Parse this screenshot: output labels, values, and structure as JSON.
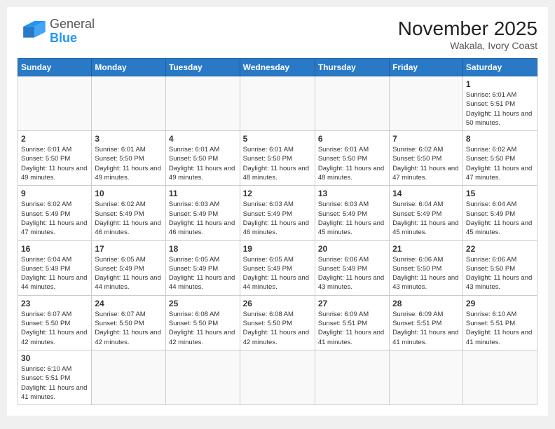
{
  "header": {
    "logo": {
      "line1": "General",
      "line2": "Blue"
    },
    "title": "November 2025",
    "location": "Wakala, Ivory Coast"
  },
  "weekdays": [
    "Sunday",
    "Monday",
    "Tuesday",
    "Wednesday",
    "Thursday",
    "Friday",
    "Saturday"
  ],
  "weeks": [
    [
      {
        "day": "",
        "info": ""
      },
      {
        "day": "",
        "info": ""
      },
      {
        "day": "",
        "info": ""
      },
      {
        "day": "",
        "info": ""
      },
      {
        "day": "",
        "info": ""
      },
      {
        "day": "",
        "info": ""
      },
      {
        "day": "1",
        "info": "Sunrise: 6:01 AM\nSunset: 5:51 PM\nDaylight: 11 hours\nand 50 minutes."
      }
    ],
    [
      {
        "day": "2",
        "info": "Sunrise: 6:01 AM\nSunset: 5:50 PM\nDaylight: 11 hours\nand 49 minutes."
      },
      {
        "day": "3",
        "info": "Sunrise: 6:01 AM\nSunset: 5:50 PM\nDaylight: 11 hours\nand 49 minutes."
      },
      {
        "day": "4",
        "info": "Sunrise: 6:01 AM\nSunset: 5:50 PM\nDaylight: 11 hours\nand 49 minutes."
      },
      {
        "day": "5",
        "info": "Sunrise: 6:01 AM\nSunset: 5:50 PM\nDaylight: 11 hours\nand 48 minutes."
      },
      {
        "day": "6",
        "info": "Sunrise: 6:01 AM\nSunset: 5:50 PM\nDaylight: 11 hours\nand 48 minutes."
      },
      {
        "day": "7",
        "info": "Sunrise: 6:02 AM\nSunset: 5:50 PM\nDaylight: 11 hours\nand 47 minutes."
      },
      {
        "day": "8",
        "info": "Sunrise: 6:02 AM\nSunset: 5:50 PM\nDaylight: 11 hours\nand 47 minutes."
      }
    ],
    [
      {
        "day": "9",
        "info": "Sunrise: 6:02 AM\nSunset: 5:49 PM\nDaylight: 11 hours\nand 47 minutes."
      },
      {
        "day": "10",
        "info": "Sunrise: 6:02 AM\nSunset: 5:49 PM\nDaylight: 11 hours\nand 46 minutes."
      },
      {
        "day": "11",
        "info": "Sunrise: 6:03 AM\nSunset: 5:49 PM\nDaylight: 11 hours\nand 46 minutes."
      },
      {
        "day": "12",
        "info": "Sunrise: 6:03 AM\nSunset: 5:49 PM\nDaylight: 11 hours\nand 46 minutes."
      },
      {
        "day": "13",
        "info": "Sunrise: 6:03 AM\nSunset: 5:49 PM\nDaylight: 11 hours\nand 45 minutes."
      },
      {
        "day": "14",
        "info": "Sunrise: 6:04 AM\nSunset: 5:49 PM\nDaylight: 11 hours\nand 45 minutes."
      },
      {
        "day": "15",
        "info": "Sunrise: 6:04 AM\nSunset: 5:49 PM\nDaylight: 11 hours\nand 45 minutes."
      }
    ],
    [
      {
        "day": "16",
        "info": "Sunrise: 6:04 AM\nSunset: 5:49 PM\nDaylight: 11 hours\nand 44 minutes."
      },
      {
        "day": "17",
        "info": "Sunrise: 6:05 AM\nSunset: 5:49 PM\nDaylight: 11 hours\nand 44 minutes."
      },
      {
        "day": "18",
        "info": "Sunrise: 6:05 AM\nSunset: 5:49 PM\nDaylight: 11 hours\nand 44 minutes."
      },
      {
        "day": "19",
        "info": "Sunrise: 6:05 AM\nSunset: 5:49 PM\nDaylight: 11 hours\nand 44 minutes."
      },
      {
        "day": "20",
        "info": "Sunrise: 6:06 AM\nSunset: 5:49 PM\nDaylight: 11 hours\nand 43 minutes."
      },
      {
        "day": "21",
        "info": "Sunrise: 6:06 AM\nSunset: 5:50 PM\nDaylight: 11 hours\nand 43 minutes."
      },
      {
        "day": "22",
        "info": "Sunrise: 6:06 AM\nSunset: 5:50 PM\nDaylight: 11 hours\nand 43 minutes."
      }
    ],
    [
      {
        "day": "23",
        "info": "Sunrise: 6:07 AM\nSunset: 5:50 PM\nDaylight: 11 hours\nand 42 minutes."
      },
      {
        "day": "24",
        "info": "Sunrise: 6:07 AM\nSunset: 5:50 PM\nDaylight: 11 hours\nand 42 minutes."
      },
      {
        "day": "25",
        "info": "Sunrise: 6:08 AM\nSunset: 5:50 PM\nDaylight: 11 hours\nand 42 minutes."
      },
      {
        "day": "26",
        "info": "Sunrise: 6:08 AM\nSunset: 5:50 PM\nDaylight: 11 hours\nand 42 minutes."
      },
      {
        "day": "27",
        "info": "Sunrise: 6:09 AM\nSunset: 5:51 PM\nDaylight: 11 hours\nand 41 minutes."
      },
      {
        "day": "28",
        "info": "Sunrise: 6:09 AM\nSunset: 5:51 PM\nDaylight: 11 hours\nand 41 minutes."
      },
      {
        "day": "29",
        "info": "Sunrise: 6:10 AM\nSunset: 5:51 PM\nDaylight: 11 hours\nand 41 minutes."
      }
    ],
    [
      {
        "day": "30",
        "info": "Sunrise: 6:10 AM\nSunset: 5:51 PM\nDaylight: 11 hours\nand 41 minutes."
      },
      {
        "day": "",
        "info": ""
      },
      {
        "day": "",
        "info": ""
      },
      {
        "day": "",
        "info": ""
      },
      {
        "day": "",
        "info": ""
      },
      {
        "day": "",
        "info": ""
      },
      {
        "day": "",
        "info": ""
      }
    ]
  ]
}
